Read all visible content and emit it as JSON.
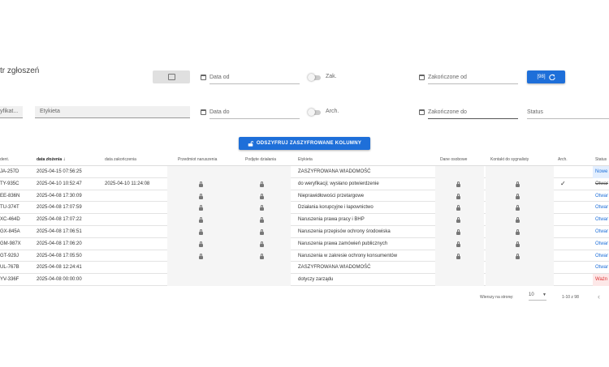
{
  "page": {
    "title": "tr zgłoszeń"
  },
  "filters": {
    "date_from_placeholder": "Data od",
    "date_to_placeholder": "Data do",
    "zak_label": "Zak.",
    "arch_label": "Arch.",
    "completed_from_placeholder": "Zakończone od",
    "completed_to_placeholder": "Zakończone do",
    "status_placeholder": "Status",
    "identifier_value": "yfikat...",
    "label_placeholder": "Etykieta"
  },
  "count_button": {
    "label": "[98]"
  },
  "decrypt_button": {
    "label": "ODSZYFRUJ ZASZYFROWANE KOLUMNY"
  },
  "table": {
    "columns": {
      "ident": "dent.",
      "data_zlozenia": "data złożenia",
      "data_zakonczenia": "data zakończenia",
      "przedmiot": "Przedmiot naruszenia",
      "podjete": "Podjęte działania",
      "etykieta": "Etykieta",
      "dane": "Dane osobowe",
      "kontakt": "Kontakt do sygnalisty",
      "arch": "Arch.",
      "status": "Status"
    },
    "rows": [
      {
        "ident": "JA-257D",
        "submitted": "2025-04-15 07:56:25",
        "completed": "",
        "subject_locked": false,
        "actions_locked": false,
        "label": "ZASZYFROWANA WIADOMOŚĆ",
        "personal_locked": false,
        "contact_locked": false,
        "archived": false,
        "status": "Nowe",
        "status_kind": "new"
      },
      {
        "ident": "TY-935C",
        "submitted": "2025-04-10 10:52:47",
        "completed": "2025-04-10 11:24:08",
        "subject_locked": true,
        "actions_locked": true,
        "label": "do weryfikacji; wysłano potwierdzenie",
        "personal_locked": true,
        "contact_locked": true,
        "archived": true,
        "status": "Otwar",
        "status_kind": "strike"
      },
      {
        "ident": "EE-836N",
        "submitted": "2025-04-08 17:30:09",
        "completed": "",
        "subject_locked": true,
        "actions_locked": true,
        "label": "Nieprawidłowości przetargowe",
        "personal_locked": true,
        "contact_locked": true,
        "archived": false,
        "status": "Otwar",
        "status_kind": "open"
      },
      {
        "ident": "TU-374T",
        "submitted": "2025-04-08 17:07:59",
        "completed": "",
        "subject_locked": true,
        "actions_locked": true,
        "label": "Działania korupcyjne i łapownictwo",
        "personal_locked": true,
        "contact_locked": true,
        "archived": false,
        "status": "Otwar",
        "status_kind": "open"
      },
      {
        "ident": "XC-464D",
        "submitted": "2025-04-08 17:07:22",
        "completed": "",
        "subject_locked": true,
        "actions_locked": true,
        "label": "Naruszenia prawa pracy i BHP",
        "personal_locked": true,
        "contact_locked": true,
        "archived": false,
        "status": "Otwar",
        "status_kind": "open"
      },
      {
        "ident": "GX-845A",
        "submitted": "2025-04-08 17:06:51",
        "completed": "",
        "subject_locked": true,
        "actions_locked": true,
        "label": "Naruszenia przepisów ochrony środowiska",
        "personal_locked": true,
        "contact_locked": true,
        "archived": false,
        "status": "Otwar",
        "status_kind": "open"
      },
      {
        "ident": "GM-987X",
        "submitted": "2025-04-08 17:06:20",
        "completed": "",
        "subject_locked": true,
        "actions_locked": true,
        "label": "Naruszenia prawa zamówień publicznych",
        "personal_locked": true,
        "contact_locked": true,
        "archived": false,
        "status": "Otwar",
        "status_kind": "open"
      },
      {
        "ident": "GT-929J",
        "submitted": "2025-04-08 17:05:50",
        "completed": "",
        "subject_locked": true,
        "actions_locked": true,
        "label": "Naruszenia w zakresie ochrony konsumentów",
        "personal_locked": true,
        "contact_locked": true,
        "archived": false,
        "status": "Otwar",
        "status_kind": "open"
      },
      {
        "ident": "UL-767B",
        "submitted": "2025-04-08 12:24:41",
        "completed": "",
        "subject_locked": false,
        "actions_locked": false,
        "label": "ZASZYFROWANA WIADOMOŚĆ",
        "personal_locked": false,
        "contact_locked": false,
        "archived": false,
        "status": "Otwar",
        "status_kind": "open"
      },
      {
        "ident": "YV-336F",
        "submitted": "2025-04-08 00:00:00",
        "completed": "",
        "subject_locked": false,
        "actions_locked": false,
        "label": "dotyczy zarządu",
        "personal_locked": false,
        "contact_locked": false,
        "archived": false,
        "status": "Ważn",
        "status_kind": "hot"
      }
    ]
  },
  "pagination": {
    "rows_per_page_label": "Wierszy na stronę:",
    "rows_per_page_value": "10",
    "range": "1-10 z 98",
    "prev_icon": "chevron-left-icon"
  },
  "colors": {
    "accent": "#1e6fd9",
    "new_bg": "#e3efff",
    "hot_bg": "#fde8e8"
  }
}
